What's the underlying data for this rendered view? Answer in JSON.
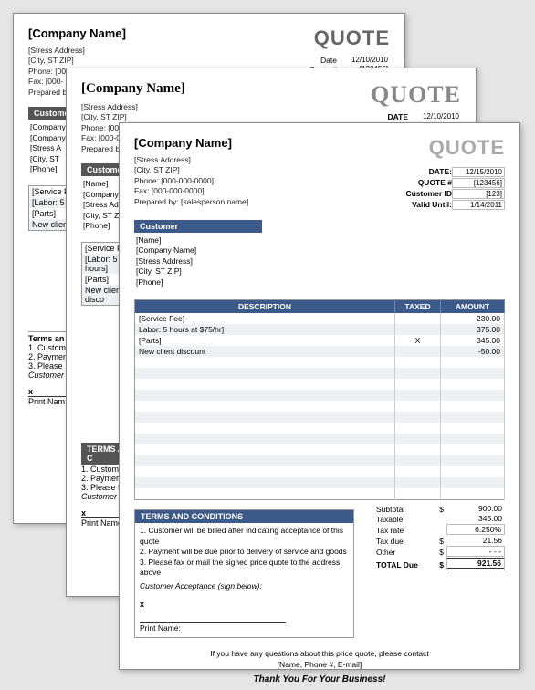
{
  "company_name": "[Company Name]",
  "quote_word": "QUOTE",
  "address": {
    "street": "[Stress Address]",
    "citystzip": "[City, ST  ZIP]",
    "phone": "Phone: [000-000-0000]",
    "fax": "Fax: [000-000-0000]",
    "prepared": "Prepared by:  [salesperson name]"
  },
  "sheet1_meta": [
    {
      "label": "Date",
      "value": "12/10/2010"
    },
    {
      "label": "Quote #",
      "value": "[123456]"
    }
  ],
  "sheet2_meta": [
    {
      "label": "DATE",
      "value": "12/10/2010"
    },
    {
      "label": "QUOTE #",
      "value": "[123456]"
    },
    {
      "label": "Customer ID",
      "value": "[123]"
    }
  ],
  "sheet3_meta": [
    {
      "label": "DATE:",
      "value": "12/15/2010"
    },
    {
      "label": "QUOTE #",
      "value": "[123456]"
    },
    {
      "label": "Customer ID",
      "value": "[123]"
    },
    {
      "label": "Valid Until:",
      "value": "1/14/2011"
    }
  ],
  "customer_header": "Customer",
  "customer": {
    "name": "[Name]",
    "company": "[Company Name]",
    "street": "[Stress Address]",
    "citystzip": "[City, ST  ZIP]",
    "phone": "[Phone]"
  },
  "table_headers": {
    "desc": "DESCRIPTION",
    "taxed": "TAXED",
    "amount": "AMOUNT"
  },
  "items": [
    {
      "desc": "[Service Fee]",
      "taxed": "",
      "amount": "230.00"
    },
    {
      "desc": "Labor: 5 hours at $75/hr]",
      "taxed": "",
      "amount": "375.00"
    },
    {
      "desc": "[Parts]",
      "taxed": "X",
      "amount": "345.00"
    },
    {
      "desc": "New client discount",
      "taxed": "",
      "amount": "-50.00"
    }
  ],
  "blank_rows": 13,
  "totals": {
    "subtotal_lbl": "Subtotal",
    "subtotal": "900.00",
    "taxable_lbl": "Taxable",
    "taxable": "345.00",
    "taxrate_lbl": "Tax rate",
    "taxrate": "6.250%",
    "taxdue_lbl": "Tax due",
    "taxdue": "21.56",
    "other_lbl": "Other",
    "other": "- - -",
    "total_lbl": "TOTAL Due",
    "total": "921.56",
    "currency": "$"
  },
  "terms_header": "TERMS AND CONDITIONS",
  "terms": [
    "1. Customer will be billed after indicating acceptance of this quote",
    "2. Payment will be due prior to delivery of service and goods",
    "3. Please fax or mail the signed price quote to the address above"
  ],
  "acceptance": "Customer Acceptance (sign below):",
  "x": "x",
  "print_name": "Print Name:",
  "footer_line": "If you have any questions about this price quote, please contact",
  "footer_contact": "[Name, Phone #, E-mail]",
  "thank_you": "Thank You For Your Business!",
  "sheet2_items_preview": [
    "[Service Fee]",
    "[Labor: 5 hours]",
    "[Parts]",
    "New client disco"
  ],
  "sheet1_items_preview": [
    "[Service F",
    "[Labor: 5",
    "[Parts]",
    "New client"
  ],
  "sheet1_terms_hdr": "Terms an",
  "sheet2_terms_hdr": "TERMS AND C",
  "sheet1_terms": [
    "1. Customer",
    "2. Paymen",
    "3. Please"
  ],
  "sheet2_terms": [
    "1. Customer will",
    "2. Payment will b",
    "3. Please fax or"
  ],
  "sheet1_accept": "Customer",
  "sheet2_accept": "Customer Accep",
  "sheet2_printname": "Print Name:",
  "sheet1_printname": "Print Nam",
  "phone_snip": "Phone: [000-",
  "fax_snip": "Fax: [000-",
  "prepared_snip": "Prepared b",
  "phone_snip2": "Phone: [000-000-000",
  "fax_snip2": "Fax: [000-000-0000]",
  "prepared_snip2": "Prepared by: [Sale",
  "s1_cust": [
    "[Company",
    "[Company",
    "[Stress A",
    "[City, ST",
    "[Phone]"
  ],
  "s2_cust": [
    "[Name]",
    "[Company Na",
    "[Stress Add",
    "[City, ST  Z",
    "[Phone]"
  ]
}
